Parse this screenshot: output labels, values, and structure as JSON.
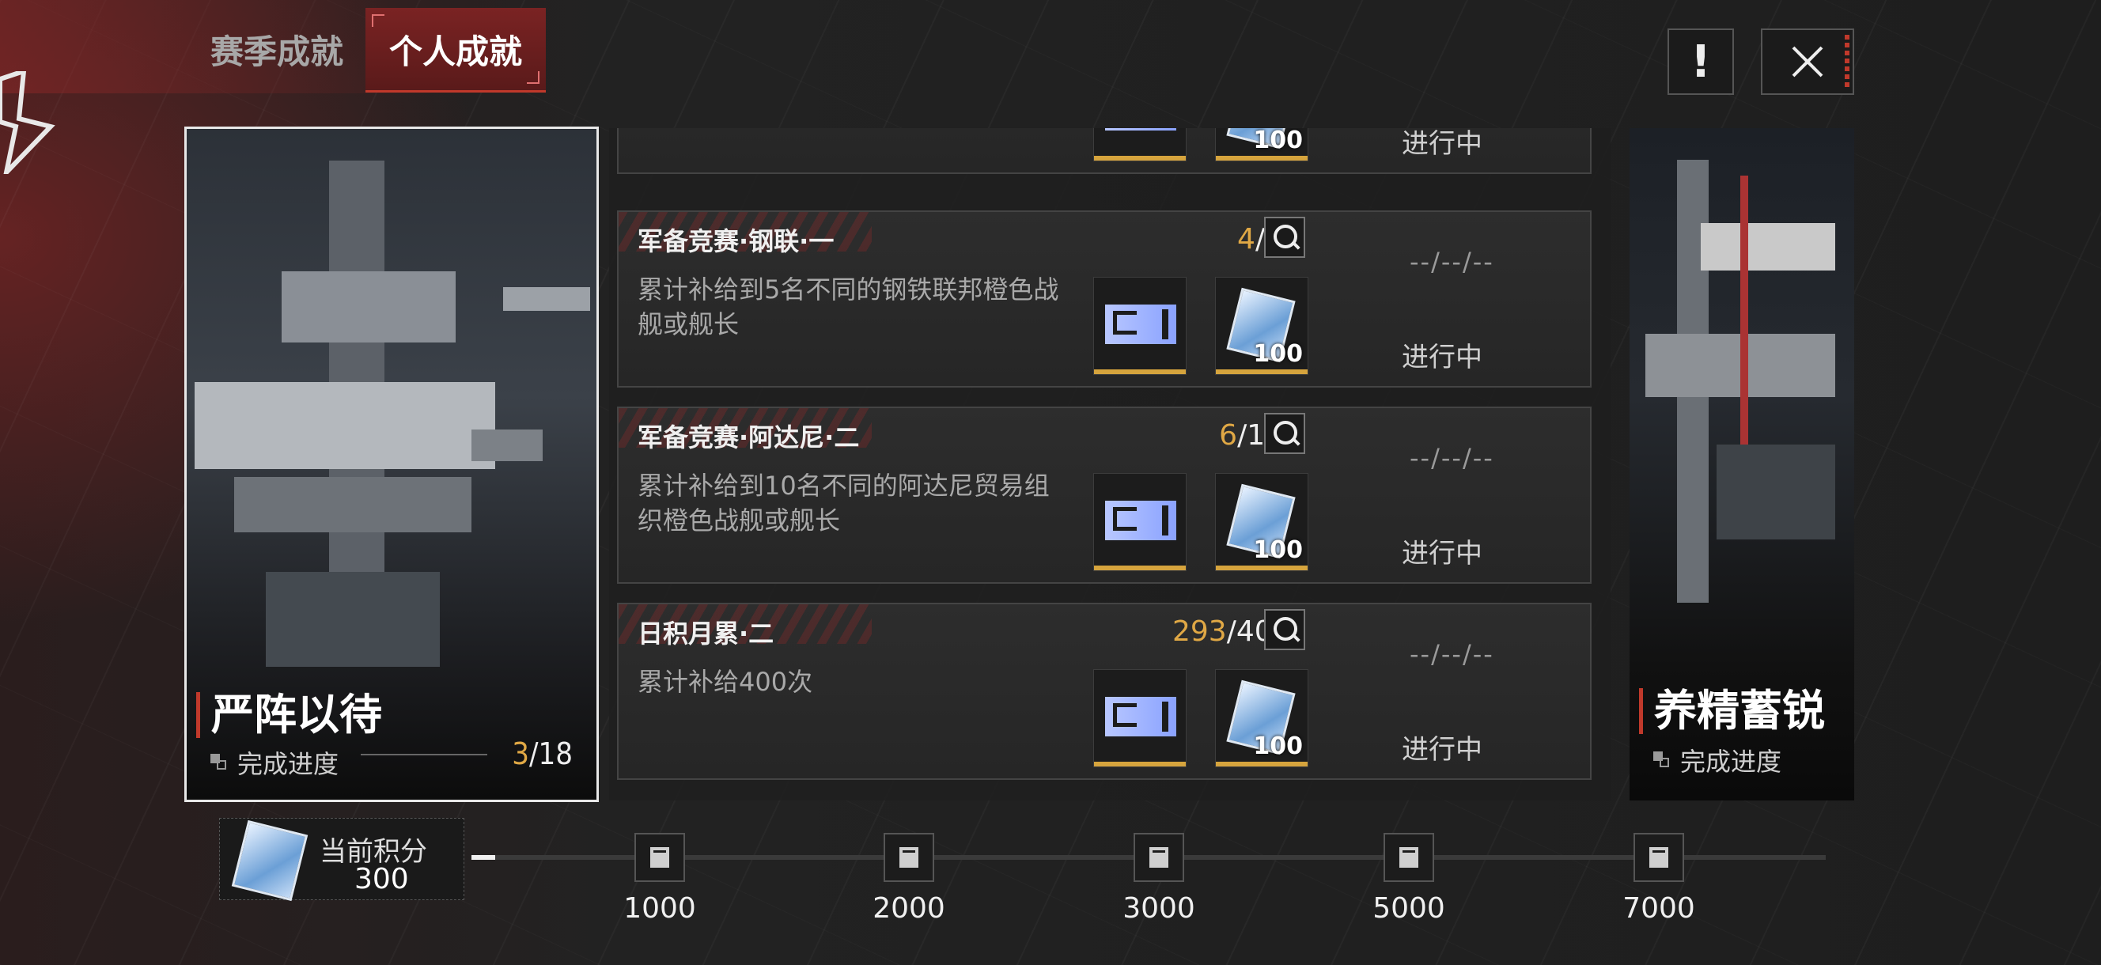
{
  "tabs": {
    "season": "赛季成就",
    "personal": "个人成就"
  },
  "header": {
    "info_label": "!"
  },
  "left_card": {
    "title": "严阵以待",
    "subtitle": "完成进度",
    "progress_current": "3",
    "progress_total": "/18"
  },
  "right_card": {
    "title": "养精蓄锐",
    "subtitle": "完成进度"
  },
  "items": [
    {
      "title": "",
      "progress_current": "",
      "progress_total": "",
      "desc": "",
      "reward_qty": "100",
      "date": "",
      "status": "进行中"
    },
    {
      "title": "军备竞赛·钢联·一",
      "progress_current": "4",
      "progress_total": "/5",
      "desc": "累计补给到5名不同的钢铁联邦橙色战舰或舰长",
      "reward_qty": "100",
      "date": "--/--/--",
      "status": "进行中"
    },
    {
      "title": "军备竞赛·阿达尼·二",
      "progress_current": "6",
      "progress_total": "/10",
      "desc": "累计补给到10名不同的阿达尼贸易组织橙色战舰或舰长",
      "reward_qty": "100",
      "date": "--/--/--",
      "status": "进行中"
    },
    {
      "title": "日积月累·二",
      "progress_current": "293",
      "progress_total": "/400",
      "desc": "累计补给400次",
      "reward_qty": "100",
      "date": "--/--/--",
      "status": "进行中"
    }
  ],
  "score": {
    "label": "当前积分",
    "value": "300",
    "progress_fraction": 0.0175
  },
  "milestones": [
    "1000",
    "2000",
    "3000",
    "5000",
    "7000"
  ],
  "colors": {
    "accent_red": "#c0392b",
    "highlight_gold": "#e0a845",
    "reward_bar": "#d6a43d"
  },
  "icons": [
    "info-icon",
    "close-icon",
    "search-icon",
    "ticket-icon",
    "crystal-icon",
    "crate-icon"
  ]
}
